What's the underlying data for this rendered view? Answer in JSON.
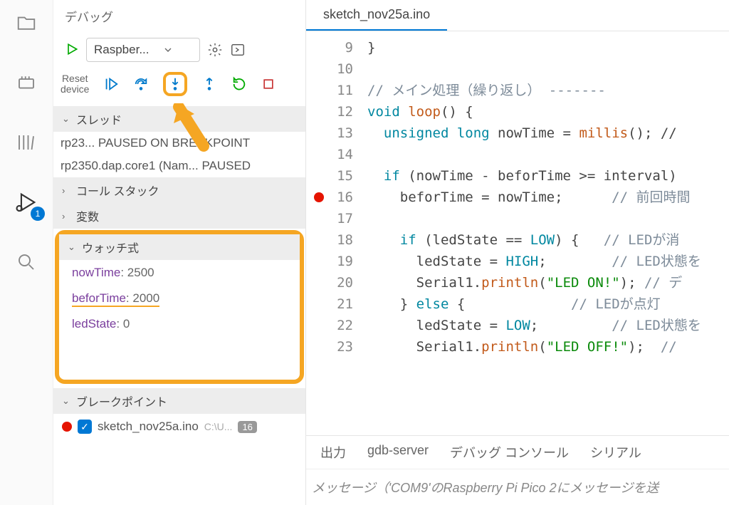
{
  "panel_title": "デバッグ",
  "run_target": "Raspber...",
  "reset_label_1": "Reset",
  "reset_label_2": "device",
  "activity_badge": "1",
  "sections": {
    "threads": "スレッド",
    "callstack": "コール スタック",
    "variables": "変数",
    "watch": "ウォッチ式",
    "breakpoints": "ブレークポイント"
  },
  "threads": [
    "rp23... PAUSED ON BREAKPOINT",
    "rp2350.dap.core1 (Nam... PAUSED"
  ],
  "watch": [
    {
      "name": "nowTime",
      "value": "2500",
      "hl": false
    },
    {
      "name": "beforTime",
      "value": "2000",
      "hl": true
    },
    {
      "name": "ledState",
      "value": "0",
      "hl": false
    }
  ],
  "bp": {
    "file": "sketch_nov25a.ino",
    "path": "C:\\U...",
    "line": "16"
  },
  "editor": {
    "tab": "sketch_nov25a.ino",
    "lines": {
      "l9": "}",
      "l10": "",
      "l11c": "// メイン処理（繰り返し） -------",
      "l12p1": "void",
      "l12f": "loop",
      "l12p2": "() {",
      "l13p1": "  unsigned",
      "l13p2": " long",
      "l13p3": " nowTime = ",
      "l13f": "millis",
      "l13p4": "(); //",
      "l14": "",
      "l15p1": "  if",
      "l15p2": " (nowTime - beforTime >= interval)",
      "l16p1": "    beforTime = nowTime;",
      "l16c": "      // 前回時間",
      "l17": "",
      "l18p1": "    if",
      "l18p2": " (ledState == ",
      "l18c": "LOW",
      "l18p3": ") {",
      "l18cm": "   // LEDが消",
      "l19p1": "      ledState = ",
      "l19c": "HIGH",
      "l19p2": ";",
      "l19cm": "        // LED状態を",
      "l20p1": "      Serial1",
      "l20p2": ".",
      "l20f": "println",
      "l20p3": "(",
      "l20s": "\"LED ON!\"",
      "l20p4": "); ",
      "l20cm": "// デ",
      "l21p1": "    } ",
      "l21k": "else",
      "l21p2": " {",
      "l21cm": "             // LEDが点灯",
      "l22p1": "      ledState = ",
      "l22c": "LOW",
      "l22p2": ";",
      "l22cm": "         // LED状態を",
      "l23p1": "      Serial1",
      "l23p2": ".",
      "l23f": "println",
      "l23p3": "(",
      "l23s": "\"LED OFF!\"",
      "l23p4": ");",
      "l23cm": "  //"
    }
  },
  "bottom_tabs": {
    "output": "出力",
    "gdb": "gdb-server",
    "console": "デバッグ コンソール",
    "serial": "シリアル"
  },
  "msg_bar": "メッセージ（'COM9'のRaspberry Pi Pico 2にメッセージを送"
}
